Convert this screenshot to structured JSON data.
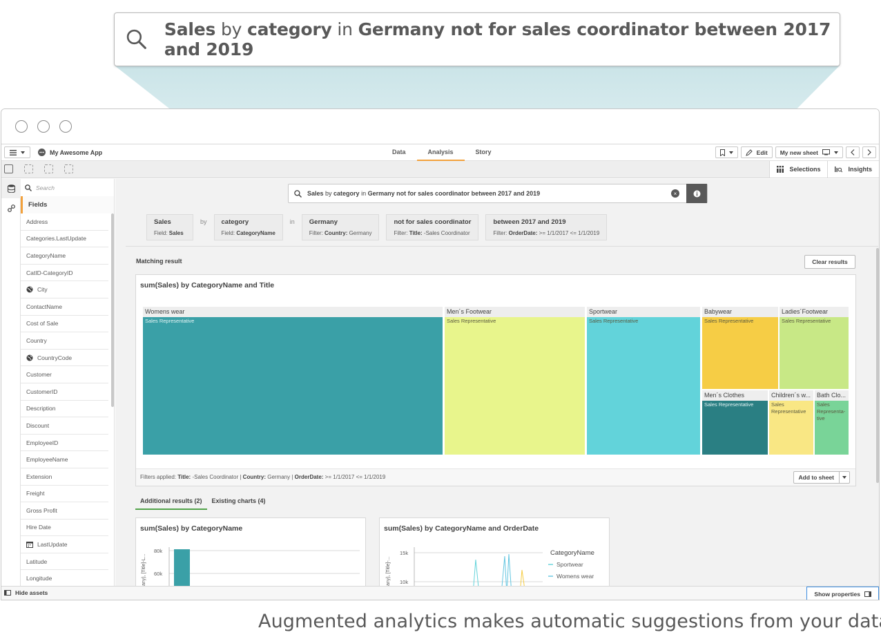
{
  "callout": {
    "query_parts": [
      {
        "text": "Sales",
        "strong": true
      },
      {
        "text": " by ",
        "strong": false
      },
      {
        "text": "category",
        "strong": true
      },
      {
        "text": " in ",
        "strong": false
      },
      {
        "text": "Germany not for sales coordinator between 2017 and 2019",
        "strong": true
      }
    ]
  },
  "app": {
    "name": "My Awesome App",
    "tabs": [
      {
        "label": "Data",
        "active": false
      },
      {
        "label": "Analysis",
        "active": true
      },
      {
        "label": "Story",
        "active": false
      }
    ],
    "edit_label": "Edit",
    "sheet_label": "My new sheet",
    "selections_label": "Selections",
    "insights_label": "Insights"
  },
  "fields_panel": {
    "search_placeholder": "Search",
    "heading": "Fields",
    "items": [
      {
        "label": "Address",
        "icon": ""
      },
      {
        "label": "Categories.LastUpdate",
        "icon": ""
      },
      {
        "label": "CategoryName",
        "icon": ""
      },
      {
        "label": "CatID-CategoryID",
        "icon": ""
      },
      {
        "label": "City",
        "icon": "globe-icon"
      },
      {
        "label": "ContactName",
        "icon": ""
      },
      {
        "label": "Cost of Sale",
        "icon": ""
      },
      {
        "label": "Country",
        "icon": ""
      },
      {
        "label": "CountryCode",
        "icon": "globe-icon"
      },
      {
        "label": "Customer",
        "icon": ""
      },
      {
        "label": "CustomerID",
        "icon": ""
      },
      {
        "label": "Description",
        "icon": ""
      },
      {
        "label": "Discount",
        "icon": ""
      },
      {
        "label": "EmployeeID",
        "icon": ""
      },
      {
        "label": "EmployeeName",
        "icon": ""
      },
      {
        "label": "Extension",
        "icon": ""
      },
      {
        "label": "Freight",
        "icon": ""
      },
      {
        "label": "Gross Profit",
        "icon": ""
      },
      {
        "label": "Hire Date",
        "icon": ""
      },
      {
        "label": "LastUpdate",
        "icon": "calendar-icon"
      },
      {
        "label": "Latitude",
        "icon": ""
      },
      {
        "label": "Longitude",
        "icon": ""
      }
    ]
  },
  "search_bar": {
    "query_parts": [
      {
        "text": "Sales",
        "strong": true
      },
      {
        "text": " by ",
        "strong": false
      },
      {
        "text": "category",
        "strong": true
      },
      {
        "text": " in ",
        "strong": false
      },
      {
        "text": "Germany not for sales coordinator between 2017 and 2019",
        "strong": true
      }
    ]
  },
  "chips": [
    {
      "title": "Sales",
      "sub_prefix": "Field: ",
      "sub_bold": "Sales",
      "sub_rest": ""
    },
    {
      "connector": "by"
    },
    {
      "title": "category",
      "sub_prefix": "Field: ",
      "sub_bold": "CategoryName",
      "sub_rest": ""
    },
    {
      "connector": "in"
    },
    {
      "title": "Germany",
      "sub_prefix": "Filter: ",
      "sub_bold": "Country:",
      "sub_rest": " Germany"
    },
    {
      "title": "not for sales coordinator",
      "sub_prefix": "Filter: ",
      "sub_bold": "Title:",
      "sub_rest": " -Sales Coordinator"
    },
    {
      "title": "between 2017 and 2019",
      "sub_prefix": "Filter: ",
      "sub_bold": "OrderDate:",
      "sub_rest": " >= 1/1/2017 <= 1/1/2019"
    }
  ],
  "results": {
    "matching_label": "Matching result",
    "clear_label": "Clear results",
    "main_chart_title": "sum(Sales) by CategoryName and Title",
    "filters_applied": [
      {
        "text": "Filters applied: ",
        "strong": false
      },
      {
        "text": "Title:",
        "strong": true
      },
      {
        "text": " -Sales Coordinator | ",
        "strong": false
      },
      {
        "text": "Country:",
        "strong": true
      },
      {
        "text": " Germany | ",
        "strong": false
      },
      {
        "text": "OrderDate:",
        "strong": true
      },
      {
        "text": " >= 1/1/2017 <= 1/1/2019",
        "strong": false
      }
    ],
    "add_to_sheet_label": "Add to sheet",
    "tabs": [
      {
        "label": "Additional results (2)",
        "active": true
      },
      {
        "label": "Existing charts (4)",
        "active": false
      }
    ],
    "small_chart_1_title": "sum(Sales) by CategoryName",
    "small_chart_2_title": "sum(Sales) by CategoryName and OrderDate"
  },
  "chart_data": [
    {
      "type": "treemap",
      "title": "sum(Sales) by CategoryName and Title",
      "nodes": [
        {
          "category": "Womens wear",
          "child": "Sales Representative",
          "color": "#3aa0a7"
        },
        {
          "category": "Men´s Footwear",
          "child": "Sales Representative",
          "color": "#e8f58c"
        },
        {
          "category": "Sportwear",
          "child": "Sales Representative",
          "color": "#62d3da"
        },
        {
          "category": "Babywear",
          "child": "Sales Representative",
          "color": "#f6cd45"
        },
        {
          "category": "Ladies´Footwear",
          "child": "Sales Representative",
          "color": "#c8e886"
        },
        {
          "category": "Men´s Clothes",
          "child": "Sales Representative",
          "color": "#2a7f83"
        },
        {
          "category": "Children´s w...",
          "child": "Sales Representative",
          "color": "#f9e784"
        },
        {
          "category": "Bath Clo...",
          "child": "Sales Representa-tive",
          "color": "#79d498"
        }
      ]
    },
    {
      "type": "bar",
      "title": "sum(Sales) by CategoryName",
      "ylabel": "any), [Title]-L...",
      "y_ticks": [
        "80k",
        "60k"
      ]
    },
    {
      "type": "line",
      "title": "sum(Sales) by CategoryName and OrderDate",
      "ylabel": "any), [Title]-...",
      "y_ticks": [
        "15k",
        "10k"
      ],
      "legend_title": "CategoryName",
      "series": [
        {
          "name": "Sportwear",
          "color": "#62d3da"
        },
        {
          "name": "Womens wear",
          "color": "#62c5e0"
        }
      ]
    }
  ],
  "bottom": {
    "hide_assets_label": "Hide assets",
    "show_properties_label": "Show properties"
  },
  "caption": "Augmented analytics makes automatic suggestions from your data."
}
